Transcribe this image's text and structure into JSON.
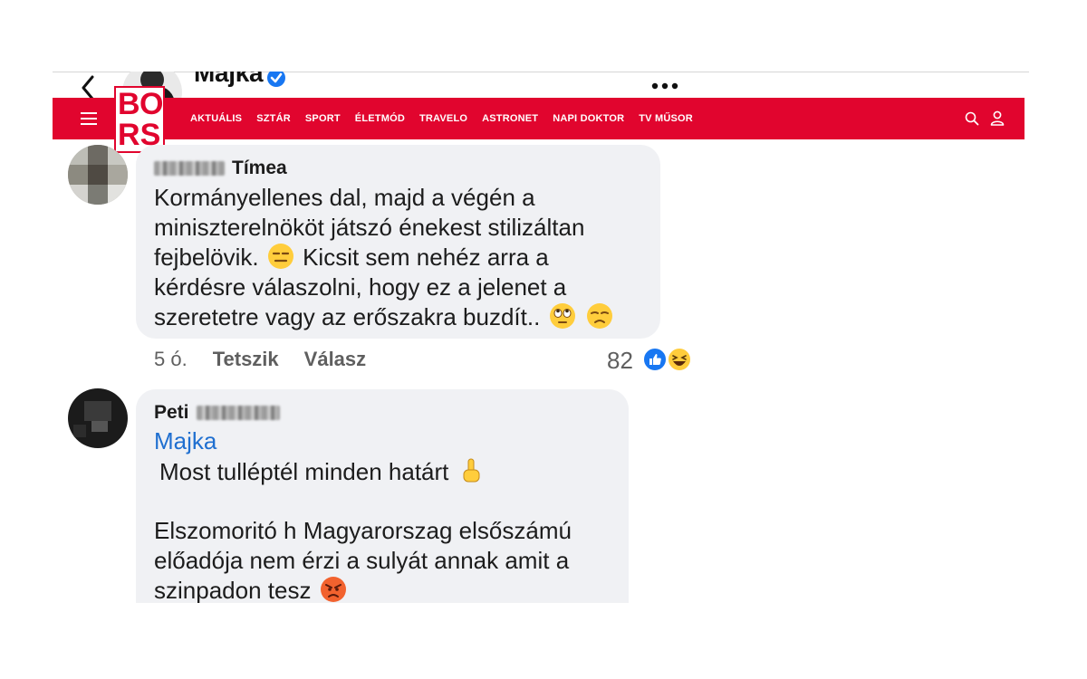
{
  "profile": {
    "name": "Majka"
  },
  "nav": {
    "logo_letters": [
      "B",
      "O",
      "R",
      "S"
    ],
    "items": [
      "AKTUÁLIS",
      "SZTÁR",
      "SPORT",
      "ÉLETMÓD",
      "TRAVELO",
      "ASTRONET",
      "NAPI DOKTOR",
      "TV MŰSOR"
    ]
  },
  "comments": [
    {
      "author_visible": "Tímea",
      "lines": [
        "Kormányellenes dal, majd a végén a",
        "miniszterelnököt játszó énekest stilizáltan",
        "fejbelövik.",
        "Kicsit sem nehéz arra a",
        "kérdésre válaszolni, hogy ez a jelenet a",
        "szeretetre vagy az erőszakra buzdít.."
      ],
      "time": "5 ó.",
      "like_label": "Tetszik",
      "reply_label": "Válasz",
      "reaction_count": "82"
    },
    {
      "author_visible": "Peti",
      "mention": "Majka",
      "lines": [
        "Most tulléptél minden határt",
        "Elszomoritó h Magyarorszag elsőszámú",
        "előadója nem érzi a sulyát annak amit a",
        "szinpadon tesz"
      ]
    }
  ],
  "colors": {
    "brand_red": "#e1052e",
    "bubble_bg": "#f0f1f4",
    "mention_blue": "#1f6fd0",
    "like_blue": "#1877f2"
  },
  "icons": [
    "back-arrow-icon",
    "verified-badge-icon",
    "more-dots-icon",
    "hamburger-menu-icon",
    "search-icon",
    "user-icon",
    "like-reaction-icon",
    "haha-reaction-icon",
    "expressionless-emoji-icon",
    "eye-roll-emoji-icon",
    "unamused-emoji-icon",
    "pointing-up-emoji-icon",
    "angry-emoji-icon"
  ]
}
